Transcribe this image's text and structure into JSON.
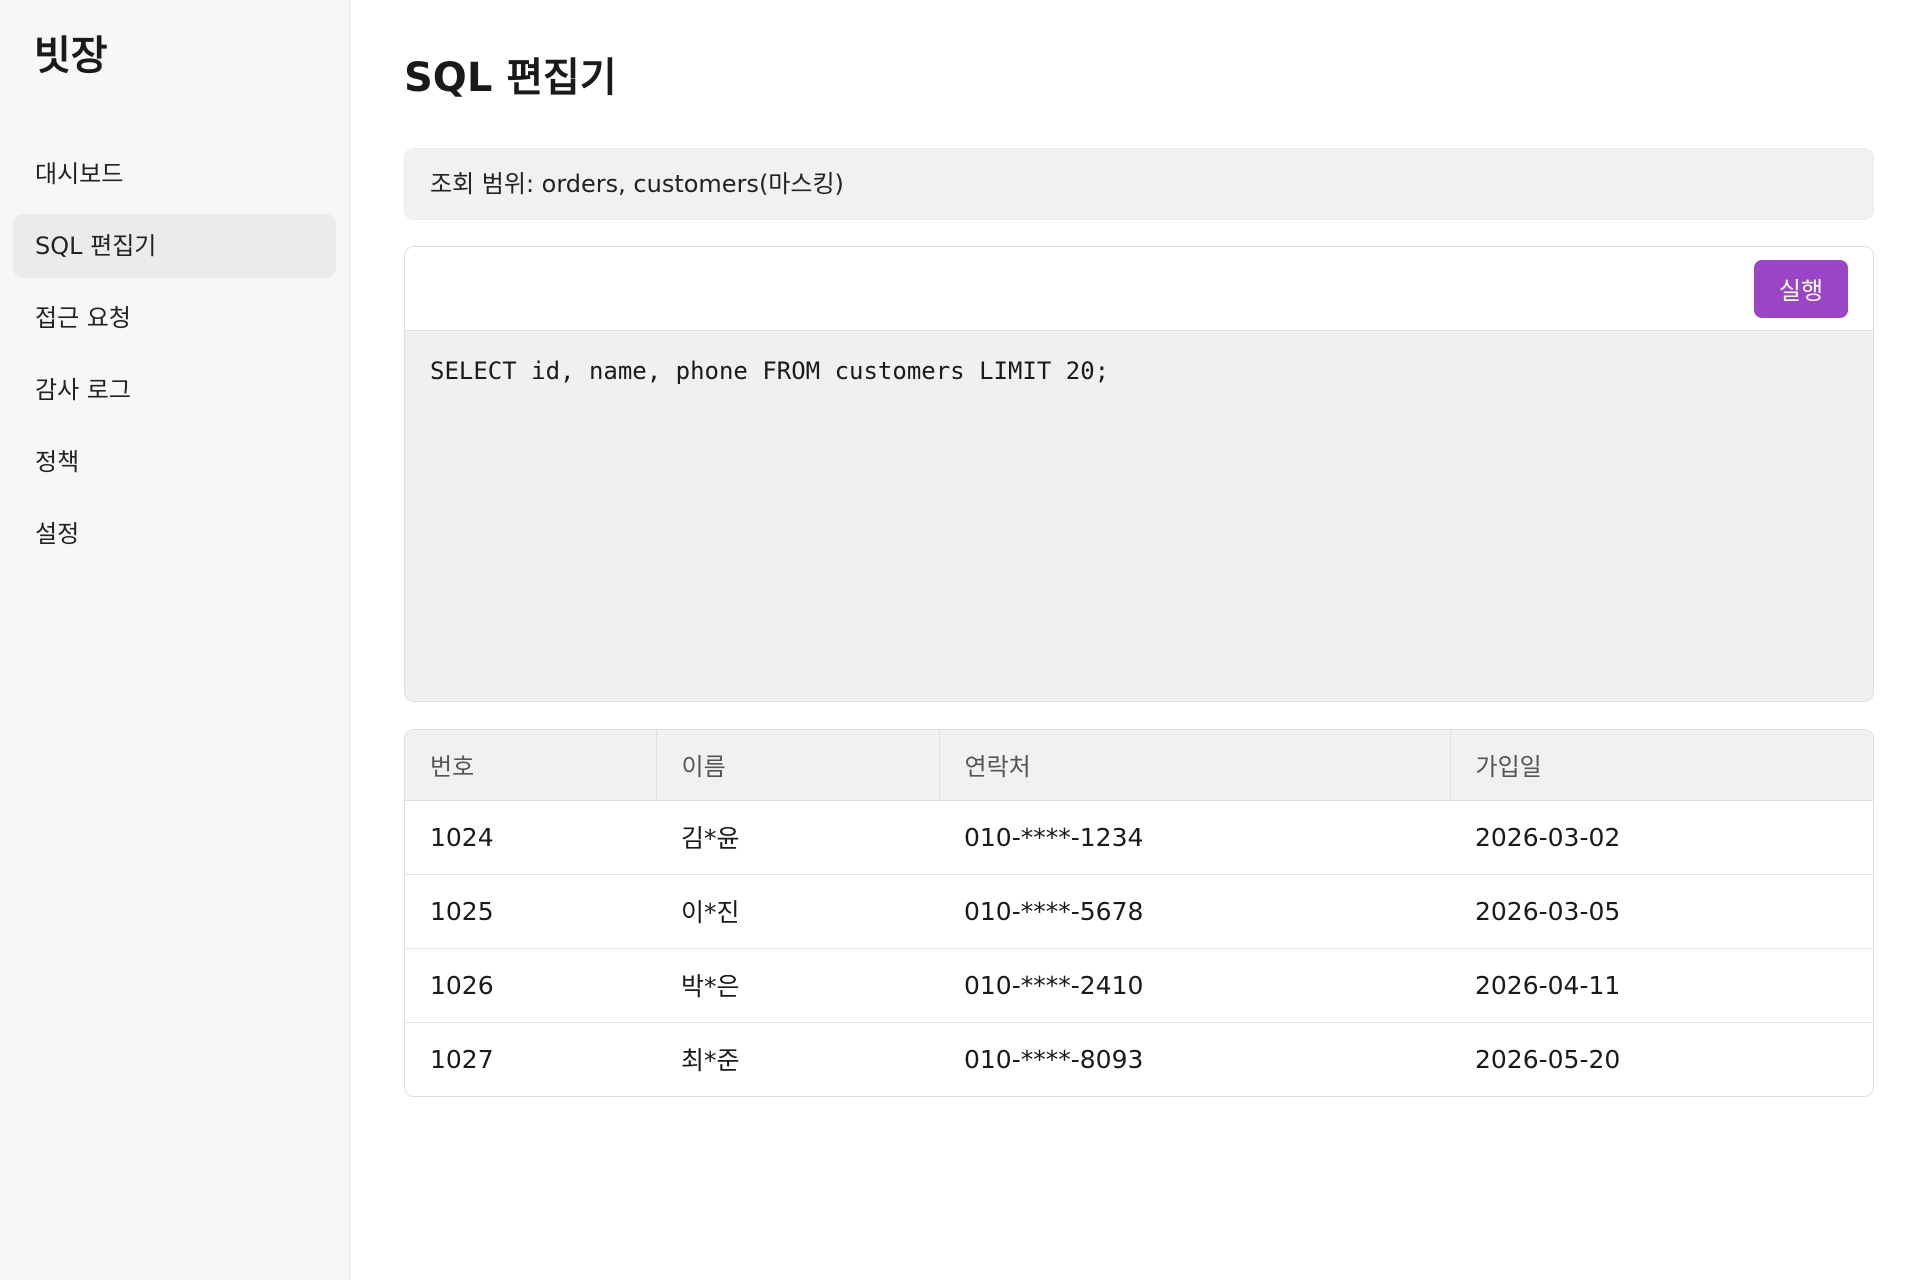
{
  "sidebar": {
    "brand": "빗장",
    "items": [
      {
        "label": "대시보드"
      },
      {
        "label": "SQL 편집기"
      },
      {
        "label": "접근 요청"
      },
      {
        "label": "감사 로그"
      },
      {
        "label": "정책"
      },
      {
        "label": "설정"
      }
    ],
    "active_item": "SQL 편집기"
  },
  "main": {
    "title": "SQL 편집기",
    "scope": "조회 범위: orders, customers(마스킹)",
    "editor": {
      "run_label": "실행",
      "query": "SELECT id, name, phone FROM customers LIMIT 20;"
    },
    "results": {
      "columns": [
        "번호",
        "이름",
        "연락처",
        "가입일"
      ],
      "rows": [
        [
          "1024",
          "김*윤",
          "010-****-1234",
          "2026-03-02"
        ],
        [
          "1025",
          "이*진",
          "010-****-5678",
          "2026-03-05"
        ],
        [
          "1026",
          "박*은",
          "010-****-2410",
          "2026-04-11"
        ],
        [
          "1027",
          "최*준",
          "010-****-8093",
          "2026-05-20"
        ]
      ]
    }
  },
  "colors": {
    "accent": "#9a44c6",
    "sidebar_bg": "#f7f7f8",
    "active_item_bg": "#ebebed",
    "editor_bg": "#f0f0f2"
  }
}
